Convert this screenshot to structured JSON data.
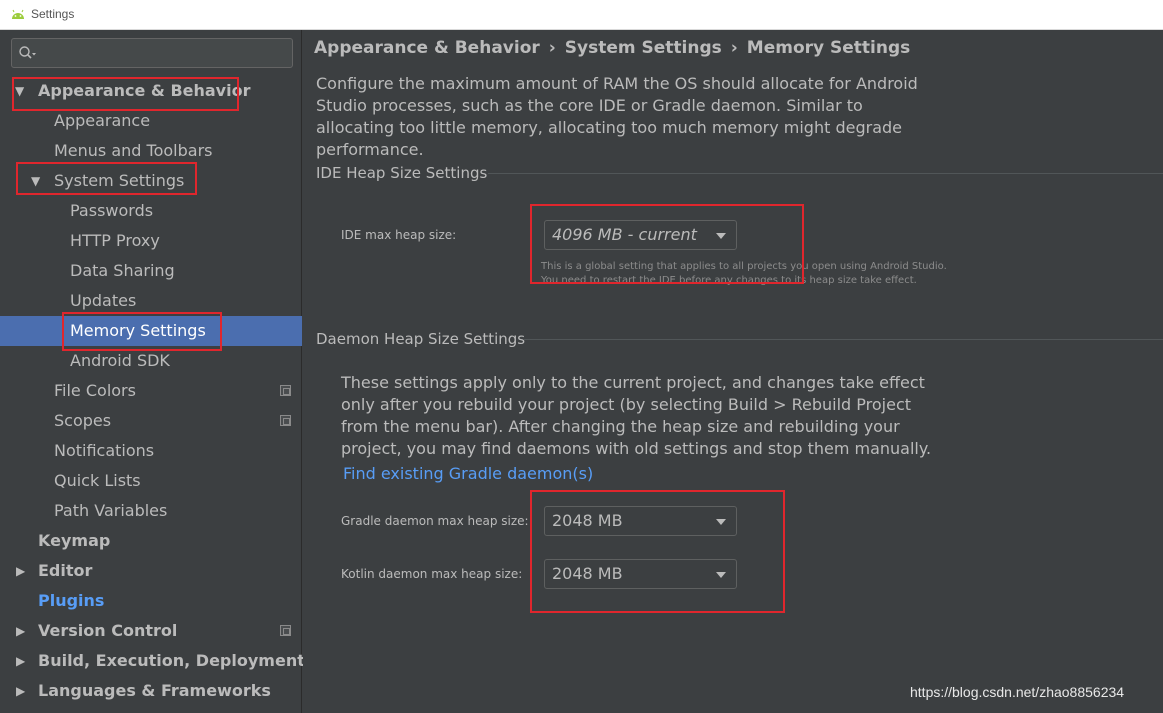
{
  "window": {
    "title": "Settings",
    "icon": "android-icon"
  },
  "search": {
    "placeholder": "",
    "icon": "search-icon"
  },
  "sidebar": {
    "items": [
      {
        "label": "Appearance & Behavior",
        "arrow": "▼"
      },
      {
        "label": "Appearance"
      },
      {
        "label": "Menus and Toolbars"
      },
      {
        "label": "System Settings",
        "arrow": "▼"
      },
      {
        "label": "Passwords"
      },
      {
        "label": "HTTP Proxy"
      },
      {
        "label": "Data Sharing"
      },
      {
        "label": "Updates"
      },
      {
        "label": "Memory Settings",
        "selected": true
      },
      {
        "label": "Android SDK"
      },
      {
        "label": "File Colors"
      },
      {
        "label": "Scopes"
      },
      {
        "label": "Notifications"
      },
      {
        "label": "Quick Lists"
      },
      {
        "label": "Path Variables"
      },
      {
        "label": "Keymap"
      },
      {
        "label": "Editor",
        "arrow": "▶"
      },
      {
        "label": "Plugins"
      },
      {
        "label": "Version Control",
        "arrow": "▶"
      },
      {
        "label": "Build, Execution, Deployment",
        "arrow": "▶"
      },
      {
        "label": "Languages & Frameworks",
        "arrow": "▶"
      }
    ]
  },
  "breadcrumb": {
    "part1": "Appearance & Behavior",
    "part2": "System Settings",
    "part3": "Memory Settings",
    "separator": "›"
  },
  "main": {
    "description": "Configure the maximum amount of RAM the OS should allocate for Android Studio processes, such as the core IDE or Gradle daemon. Similar to allocating too little memory, allocating too much memory might degrade performance.",
    "ide_section": {
      "title": "IDE Heap Size Settings",
      "label": "IDE max heap size:",
      "value": "4096 MB - current",
      "hint_line1": "This is a global setting that applies to all projects you open using Android Studio.",
      "hint_line2": "You need to restart the IDE before any changes to its heap size take effect."
    },
    "daemon_section": {
      "title": "Daemon Heap Size Settings",
      "description": "These settings apply only to the current project, and changes take effect only after you rebuild your project (by selecting Build > Rebuild Project from the menu bar). After changing the heap size and rebuilding your project, you may find daemons with old settings and stop them manually.",
      "link": "Find existing Gradle daemon(s)",
      "gradle_label": "Gradle daemon max heap size:",
      "gradle_value": "2048 MB",
      "kotlin_label": "Kotlin daemon max heap size:",
      "kotlin_value": "2048 MB"
    }
  },
  "watermark": "https://blog.csdn.net/zhao8856234",
  "colors": {
    "background": "#3c3f41",
    "selection": "#4b6eaf",
    "link": "#589df6",
    "highlight_box": "#e0262d"
  }
}
